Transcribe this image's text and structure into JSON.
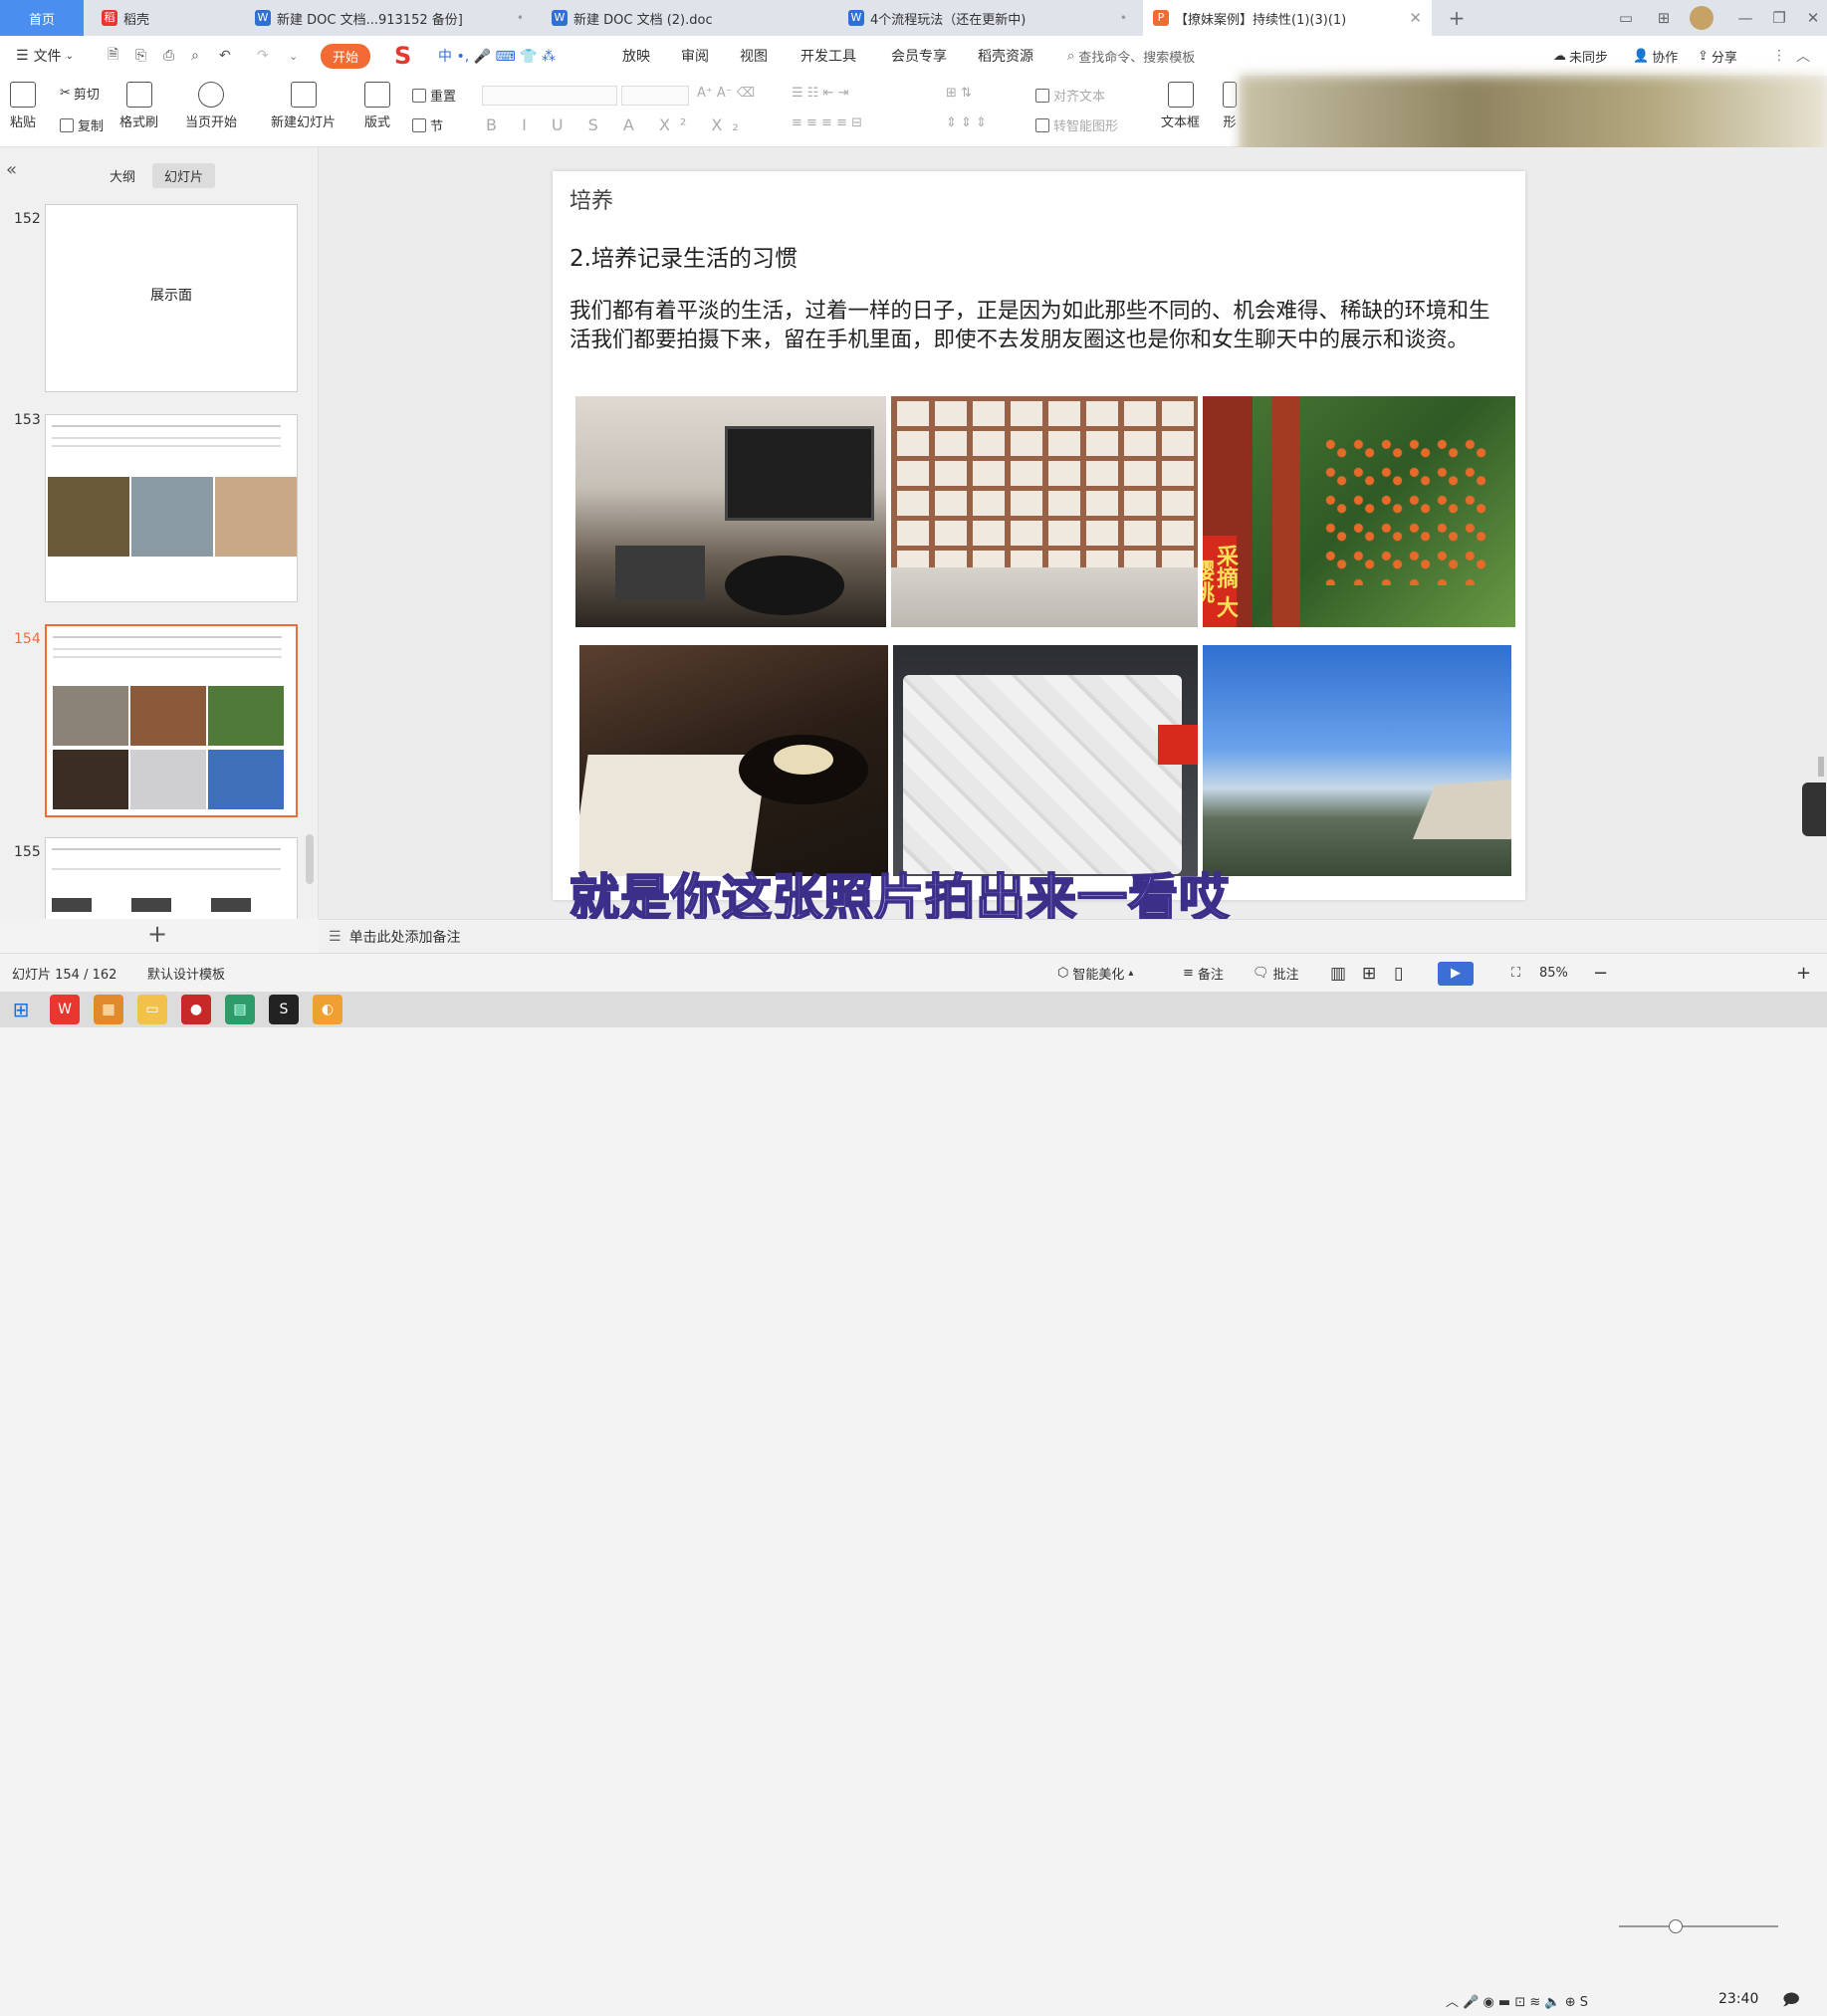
{
  "tabs": [
    {
      "label": "首页"
    },
    {
      "label": "稻壳"
    },
    {
      "label": "新建 DOC 文档...913152 备份]"
    },
    {
      "label": "新建 DOC 文档 (2).doc"
    },
    {
      "label": "4个流程玩法（还在更新中)"
    },
    {
      "label": "【撩妹案例】持续性(1)(3)(1)"
    }
  ],
  "menu": {
    "file": "文件",
    "start": "开始",
    "items": [
      "放映",
      "审阅",
      "视图",
      "开发工具",
      "会员专享",
      "稻壳资源"
    ],
    "search_placeholder": "查找命令、搜索模板",
    "sync": "未同步",
    "collab": "协作",
    "share": "分享"
  },
  "ribbon": {
    "paste": "粘贴",
    "cut": "剪切",
    "copy": "复制",
    "format_painter": "格式刷",
    "from_current": "当页开始",
    "new_slide": "新建幻灯片",
    "layout": "版式",
    "reset": "重置",
    "section": "节",
    "align_text": "对齐文本",
    "smart_shape": "转智能图形",
    "textbox": "文本框",
    "shape_partial": "形"
  },
  "panel": {
    "outline_tab": "大纲",
    "slides_tab": "幻灯片",
    "thumbnails": [
      {
        "num": "152",
        "text": "展示面"
      },
      {
        "num": "153",
        "text": ""
      },
      {
        "num": "154",
        "text": ""
      },
      {
        "num": "155",
        "text": ""
      }
    ]
  },
  "slide": {
    "header": "培养",
    "heading": "2.培养记录生活的习惯",
    "body": "我们都有着平淡的生活，过着一样的日子，正是因为如此那些不同的、机会难得、稀缺的环境和生活我们都要拍摄下来，留在手机里面，即使不去发朋友圈这也是你和女生聊天中的展示和谈资。",
    "sign_text": "采摘 大樱桃"
  },
  "subtitle": "就是你这张照片拍出来一看哎",
  "notes_placeholder": "单击此处添加备注",
  "status": {
    "slide_counter": "幻灯片 154 / 162",
    "template": "默认设计模板",
    "beautify": "智能美化",
    "notes": "备注",
    "comment": "批注",
    "zoom": "85%",
    "zoom_level": 0.85
  },
  "taskbar": {
    "time": "23:40"
  },
  "colors": {
    "accent": "#f26b35",
    "home_tab": "#4a8ef0",
    "subtitle_fill": "#cfc6ff",
    "subtitle_stroke": "#3b2f8a"
  }
}
